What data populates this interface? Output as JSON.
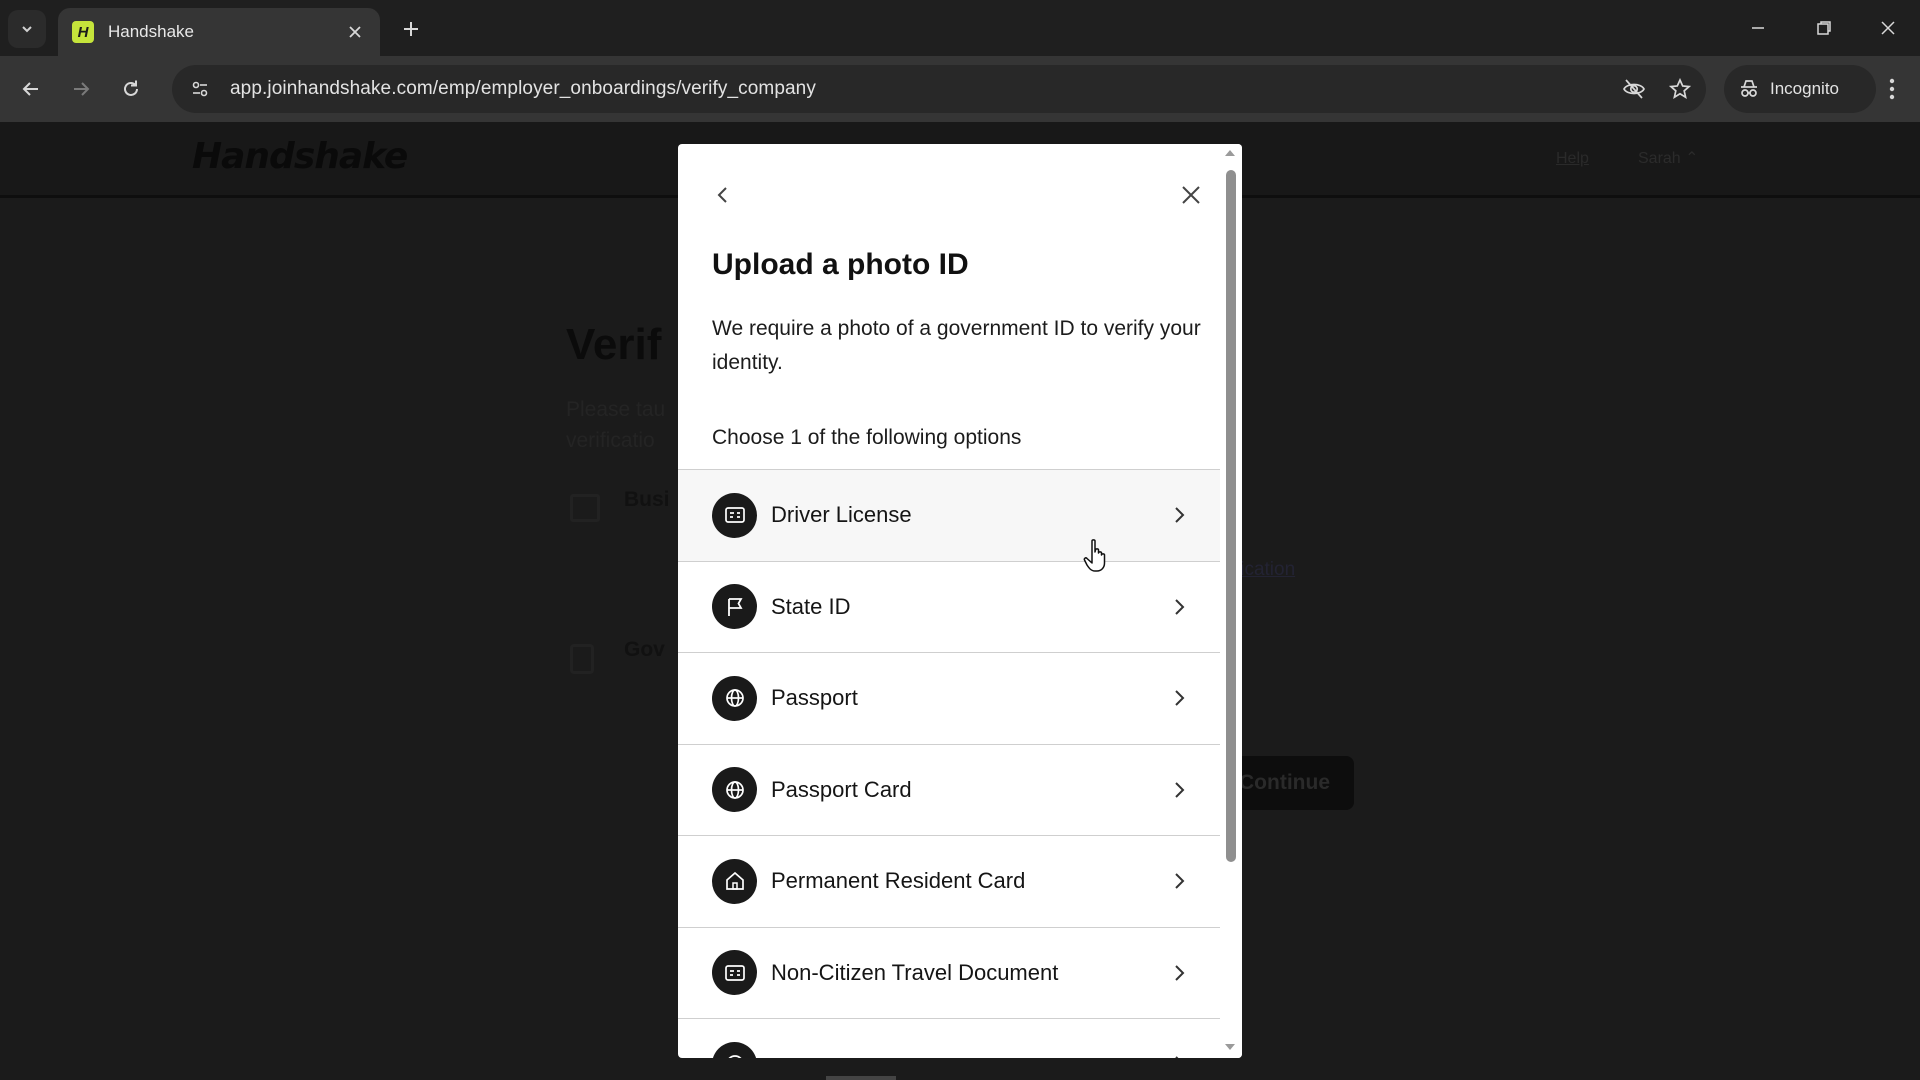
{
  "browser": {
    "tab_title": "Handshake",
    "favicon_letter": "H",
    "url": "app.joinhandshake.com/emp/employer_onboardings/verify_company",
    "incognito_label": "Incognito"
  },
  "background_page": {
    "logo": "Handshake",
    "help_link": "Help",
    "user_menu": "Sarah",
    "title": "Verif",
    "subtitle": "Please tau verificatio",
    "items": [
      {
        "title": "Busi"
      },
      {
        "title": "Gov"
      }
    ],
    "link_text": "lication",
    "continue_label": "Continue"
  },
  "modal": {
    "title": "Upload a photo ID",
    "description": "We require a photo of a government ID to verify your identity.",
    "choose_prompt": "Choose 1 of the following options",
    "options": [
      {
        "label": "Driver License",
        "icon": "id-card-icon"
      },
      {
        "label": "State ID",
        "icon": "flag-icon"
      },
      {
        "label": "Passport",
        "icon": "globe-icon"
      },
      {
        "label": "Passport Card",
        "icon": "globe-icon"
      },
      {
        "label": "Permanent Resident Card",
        "icon": "home-icon"
      },
      {
        "label": "Non-Citizen Travel Document",
        "icon": "id-card-icon"
      },
      {
        "label": "",
        "icon": "globe-icon"
      }
    ]
  }
}
